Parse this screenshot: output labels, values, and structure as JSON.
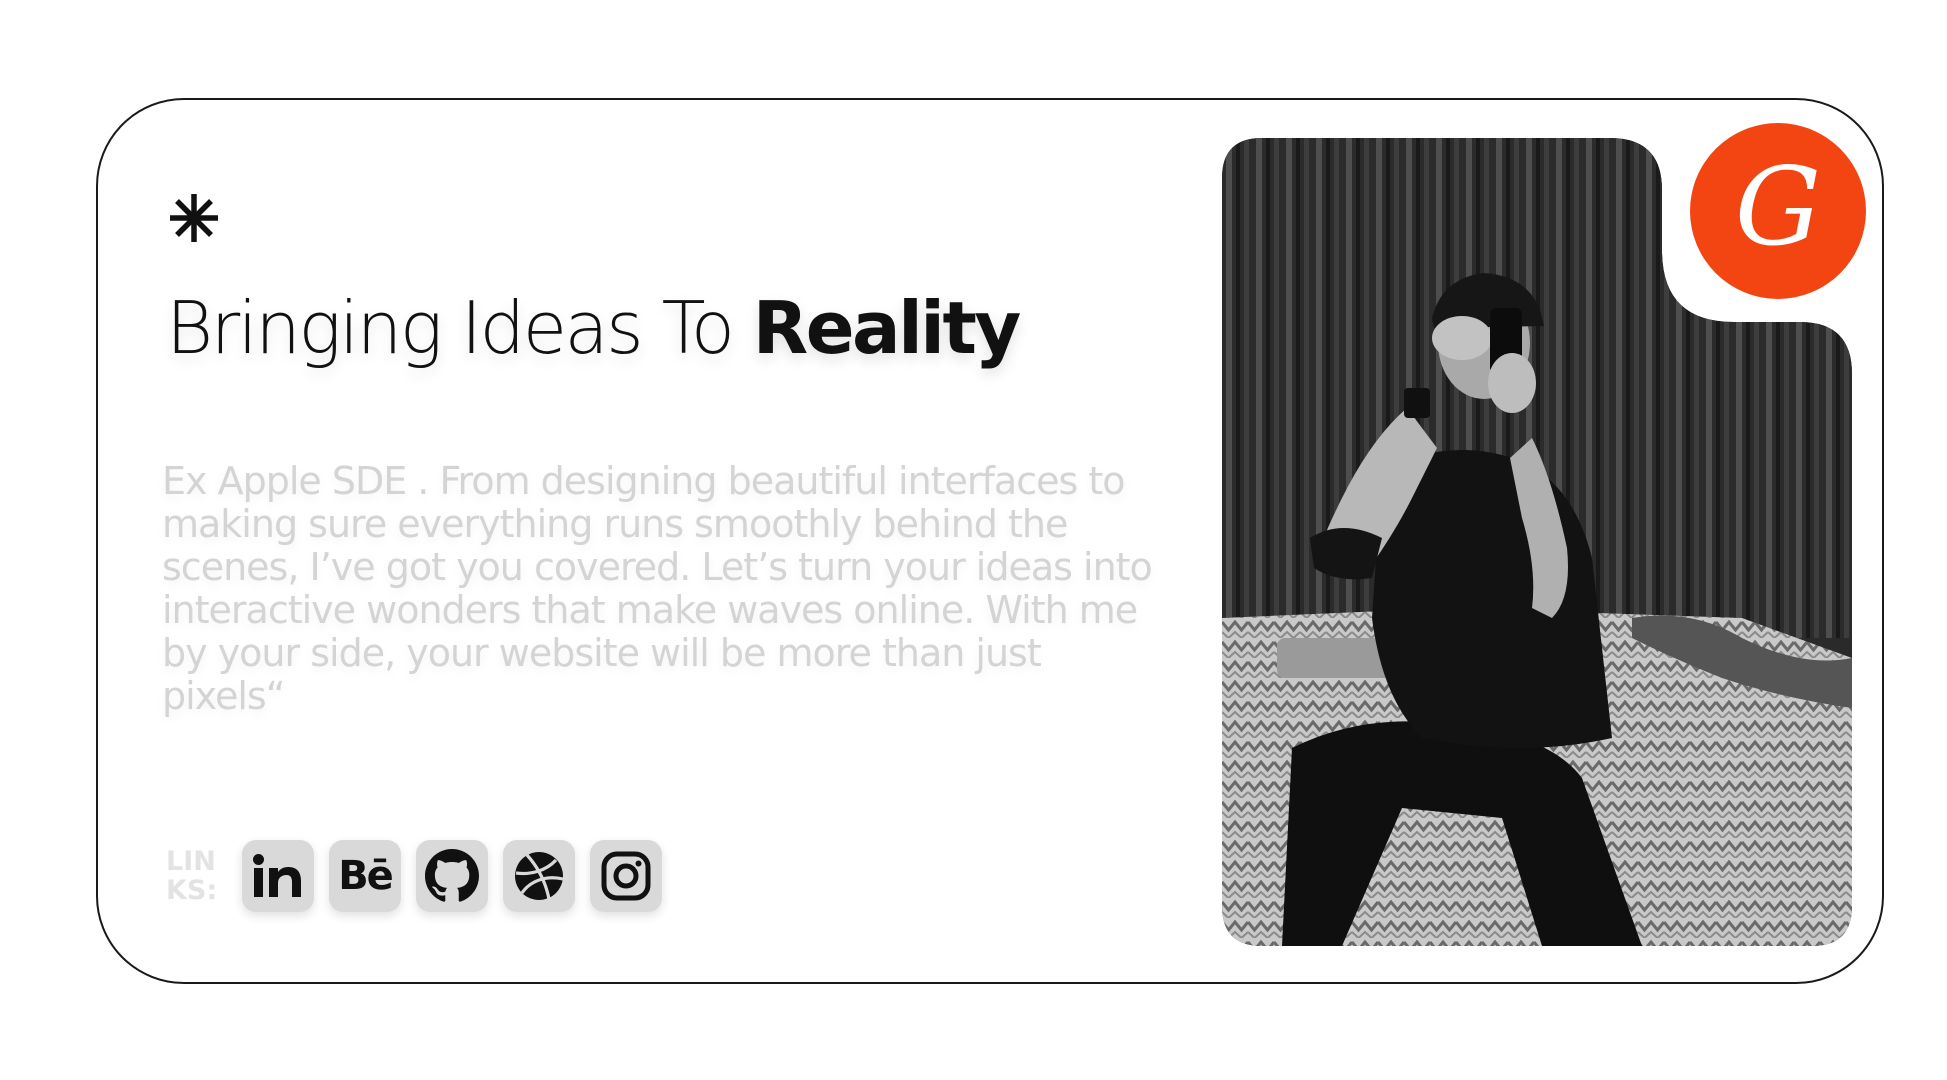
{
  "hero": {
    "headline_regular": "Bringing Ideas To ",
    "headline_bold": "Reality",
    "bio": "Ex Apple SDE . From designing beautiful interfaces to making sure everything runs smoothly behind the scenes, I’ve got you covered. Let’s turn your ideas into interactive wonders that make waves online. With me by your side, your website will be more than just pixels“"
  },
  "links": {
    "label": "LINKS:",
    "items": [
      {
        "name": "LinkedIn",
        "icon": "linkedin-icon",
        "glyph": "in"
      },
      {
        "name": "Behance",
        "icon": "behance-icon",
        "glyph": "Bē"
      },
      {
        "name": "GitHub",
        "icon": "github-icon"
      },
      {
        "name": "Dribbble",
        "icon": "dribbble-icon"
      },
      {
        "name": "Instagram",
        "icon": "instagram-icon"
      }
    ]
  },
  "logo": {
    "letter": "G",
    "color": "#f24512"
  },
  "colors": {
    "accent": "#f24512",
    "text": "#111111",
    "muted_text": "#d4d4d4",
    "icon_bg": "#d9d9d9"
  },
  "photo": {
    "icon": "portrait-photo"
  }
}
